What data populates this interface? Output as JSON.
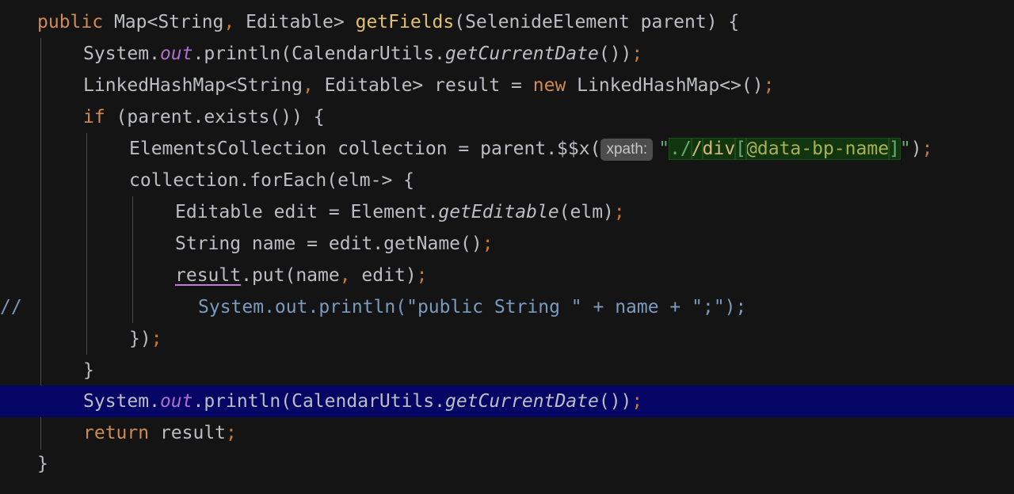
{
  "editor": {
    "line_marker": "//",
    "lines": [
      {
        "tokens": [
          {
            "t": "public ",
            "c": "kw"
          },
          {
            "t": "Map<String",
            "c": ""
          },
          {
            "t": ",",
            "c": "pun"
          },
          {
            "t": " Editable> ",
            "c": ""
          },
          {
            "t": "getFields",
            "c": "fn"
          },
          {
            "t": "(SelenideElement parent) {",
            "c": ""
          }
        ]
      },
      {
        "tokens": [
          {
            "t": "System.",
            "c": ""
          },
          {
            "t": "out",
            "c": "fld"
          },
          {
            "t": ".println(CalendarUtils.",
            "c": ""
          },
          {
            "t": "getCurrentDate",
            "c": "ita"
          },
          {
            "t": "())",
            "c": ""
          },
          {
            "t": ";",
            "c": "pun"
          }
        ]
      },
      {
        "tokens": [
          {
            "t": "LinkedHashMap<String",
            "c": ""
          },
          {
            "t": ",",
            "c": "pun"
          },
          {
            "t": " Editable> result = ",
            "c": ""
          },
          {
            "t": "new ",
            "c": "kw"
          },
          {
            "t": "LinkedHashMap<>()",
            "c": ""
          },
          {
            "t": ";",
            "c": "pun"
          }
        ]
      },
      {
        "tokens": [
          {
            "t": "if ",
            "c": "kw"
          },
          {
            "t": "(parent.exists()) {",
            "c": ""
          }
        ]
      },
      {
        "tokens": [
          {
            "t": "ElementsCollection collection = parent.$$x(",
            "c": ""
          },
          {
            "t": "xpath:",
            "c": "hint"
          },
          {
            "t": "\"",
            "c": "str"
          },
          {
            "t": "./",
            "c": "str inject"
          },
          {
            "t": "/",
            "c": "tag inject"
          },
          {
            "t": "div",
            "c": "tag inject"
          },
          {
            "t": "[",
            "c": "str inject"
          },
          {
            "t": "@data-bp-name",
            "c": "attr inject"
          },
          {
            "t": "]",
            "c": "str inject"
          },
          {
            "t": "\"",
            "c": "str"
          },
          {
            "t": ")",
            "c": ""
          },
          {
            "t": ";",
            "c": "pun"
          }
        ]
      },
      {
        "tokens": [
          {
            "t": "collection.forEach(elm-> {",
            "c": ""
          }
        ]
      },
      {
        "tokens": [
          {
            "t": "Editable edit = Element.",
            "c": ""
          },
          {
            "t": "getEditable",
            "c": "ita"
          },
          {
            "t": "(elm)",
            "c": ""
          },
          {
            "t": ";",
            "c": "pun"
          }
        ]
      },
      {
        "tokens": [
          {
            "t": "String name = edit.getName()",
            "c": ""
          },
          {
            "t": ";",
            "c": "pun"
          }
        ]
      },
      {
        "tokens": [
          {
            "t": "result",
            "c": "err"
          },
          {
            "t": ".put(name",
            "c": ""
          },
          {
            "t": ",",
            "c": "pun"
          },
          {
            "t": " edit)",
            "c": ""
          },
          {
            "t": ";",
            "c": "pun"
          }
        ]
      },
      {
        "tokens": [
          {
            "t": "System.out.println(\"public String \" + name + \";\");",
            "c": "cmt"
          }
        ]
      },
      {
        "tokens": [
          {
            "t": "})",
            "c": ""
          },
          {
            "t": ";",
            "c": "pun"
          }
        ]
      },
      {
        "tokens": [
          {
            "t": "}",
            "c": ""
          }
        ]
      },
      {
        "tokens": [
          {
            "t": "System.",
            "c": ""
          },
          {
            "t": "out",
            "c": "fld"
          },
          {
            "t": ".println(CalendarUtils.",
            "c": ""
          },
          {
            "t": "getCurrentDate",
            "c": "ita"
          },
          {
            "t": "())",
            "c": ""
          },
          {
            "t": ";",
            "c": "pun"
          }
        ]
      },
      {
        "tokens": [
          {
            "t": "return ",
            "c": "kw"
          },
          {
            "t": "result",
            "c": ""
          },
          {
            "t": ";",
            "c": "pun"
          }
        ]
      },
      {
        "tokens": [
          {
            "t": "}",
            "c": ""
          }
        ]
      }
    ]
  }
}
